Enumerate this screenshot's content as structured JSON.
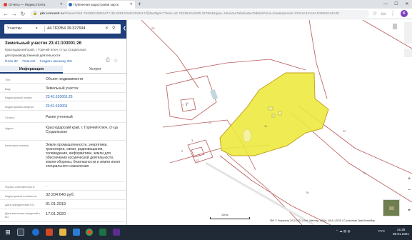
{
  "browser": {
    "tabs": [
      {
        "title": "Отчеты — Яндекс.Почта"
      },
      {
        "title": "Публичная кадастровая карта"
      }
    ],
    "new_tab_symbol": "+",
    "window_controls": [
      "—",
      "☐",
      "✕"
    ],
    "url_host": "pkk.rosreestr.ru",
    "url_path": "/#/search/44.76338315834477,39.3281019412034/17/@5w3tgnc??text=44.763354%2039.327694&type=1&nameTab&indexTab&inPoint=true&opened=23%3A41%3A103001%3A26",
    "profile_initial": "K"
  },
  "panel": {
    "search_type": "Участки",
    "search_query": "44.763354 39.327694",
    "title": "Земельный участок 23:41:103001:26",
    "address_line": "Краснодарский край, г. Горячий Ключ, ст-ца Суздальская",
    "use": "для производственной деятельности",
    "links": [
      "План ЗУ",
      "План КК",
      "Создать выписку ЖС"
    ],
    "tabs": {
      "info": "Информация",
      "services": "Услуги"
    },
    "rows": [
      {
        "label": "Тип:",
        "value": "Объект недвижимости",
        "link": false
      },
      {
        "label": "Вид:",
        "value": "Земельный участок",
        "link": false
      },
      {
        "label": "Кадастровый номер:",
        "value": "23:41:103001:26",
        "link": true
      },
      {
        "label": "Кадастровый квартал:",
        "value": "23:41:103001",
        "link": true
      },
      {
        "label": "Статус:",
        "value": "Ранее учтенный",
        "link": false
      },
      {
        "label": "Адрес:",
        "value": "Краснодарский край, г. Горячий Ключ, ст-ца Суздальская",
        "link": false
      },
      {
        "label": "Категория земель:",
        "value": "Земли промышленности, энергетики, транспорта, связи, радиовещания, телевидения, информатики, земли для обеспечения космической деятельности, земли обороны, безопасности и земли иного специального назначения",
        "link": false
      },
      {
        "label": "Форма собственности:",
        "value": "-",
        "link": false
      },
      {
        "label": "Кадастровая стоимость:",
        "value": "32 204 640 руб.",
        "link": false
      },
      {
        "label": "Дата определения КС:",
        "value": "01.01.2019",
        "link": false
      },
      {
        "label": "Дата внесения сведений о КС:",
        "value": "17.01.2020",
        "link": false
      }
    ]
  },
  "map": {
    "scale_label": "100 м",
    "attribution": "ПКК © Росреестр 2010-2021 | Esri, Intermap, NASA, NGA, USGS | © участники OpenStreetMap",
    "controls": [
      "+",
      "−",
      "⌖"
    ],
    "labels": [
      "23",
      "7",
      "5",
      "8",
      "24",
      "11",
      "12",
      "11",
      "2",
      "3",
      "12",
      "75",
      "76"
    ],
    "parcel_fill": "#ece93a",
    "parcel_stroke": "#c7a21a",
    "boundary_color": "#b85a5a"
  },
  "taskbar": {
    "tray_lang": "РУС",
    "time": "14:38",
    "date": "09.01.2021"
  }
}
